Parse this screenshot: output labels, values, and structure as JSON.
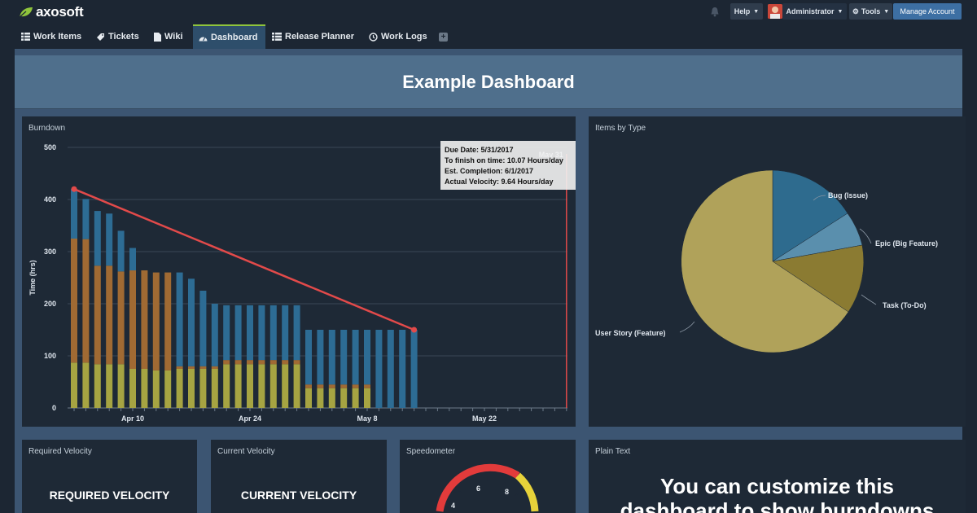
{
  "brand": {
    "name": "axosoft"
  },
  "topbar": {
    "help_label": "Help",
    "user_label": "Administrator",
    "tools_label": "Tools",
    "manage_label": "Manage Account"
  },
  "nav": {
    "tabs": [
      {
        "label": "Work Items",
        "icon": "list-icon"
      },
      {
        "label": "Tickets",
        "icon": "ticket-icon"
      },
      {
        "label": "Wiki",
        "icon": "document-icon"
      },
      {
        "label": "Dashboard",
        "icon": "dashboard-icon",
        "active": true
      },
      {
        "label": "Release Planner",
        "icon": "release-planner-icon"
      },
      {
        "label": "Work Logs",
        "icon": "clock-icon"
      }
    ],
    "add_label": "+"
  },
  "dashboard": {
    "title": "Example Dashboard",
    "burndown": {
      "title": "Burndown",
      "ylabel": "Time (hrs)",
      "y_ticks": [
        "500",
        "400",
        "300",
        "200",
        "100",
        "0"
      ],
      "x_ticks": [
        "Apr 10",
        "Apr 24",
        "May 8",
        "May 22"
      ],
      "marker_label": "May 31",
      "tooltip": {
        "line1": "Due Date: 5/31/2017",
        "line2": "To finish on time: 10.07 Hours/day",
        "line3": "Est. Completion: 6/1/2017",
        "line4": "Actual Velocity: 9.64 Hours/day"
      }
    },
    "items_by_type": {
      "title": "Items by Type",
      "labels": {
        "bug": "Bug (Issue)",
        "epic": "Epic (Big Feature)",
        "task": "Task (To-Do)",
        "story": "User Story (Feature)"
      }
    },
    "required_velocity": {
      "title": "Required Velocity",
      "big": "REQUIRED VELOCITY"
    },
    "current_velocity": {
      "title": "Current Velocity",
      "big": "CURRENT VELOCITY"
    },
    "speedometer": {
      "title": "Speedometer",
      "ticks": [
        "4",
        "6",
        "8"
      ]
    },
    "plain_text": {
      "title": "Plain Text",
      "line1": "You can customize this",
      "line2": "dashboard to show burndowns"
    }
  },
  "colors": {
    "blue": "#2d6c94",
    "orange": "#a06a33",
    "olive": "#a6a442",
    "ideal_line": "#e24a4a",
    "pie_story": "#b0a25a",
    "pie_bug": "#2e6b8e",
    "pie_epic": "#5a8fad",
    "pie_task": "#8b7b32"
  },
  "chart_data": {
    "type": "bar",
    "title": "Burndown",
    "ylabel": "Time (hrs)",
    "ylim": [
      0,
      500
    ],
    "x_ticks": [
      "Apr 10",
      "Apr 24",
      "May 8",
      "May 22"
    ],
    "series": [
      {
        "name": "",
        "color": "#a6a442",
        "values": [
          87,
          87,
          84,
          84,
          84,
          75,
          75,
          72,
          72,
          75,
          75,
          75,
          75,
          84,
          84,
          84,
          84,
          84,
          84,
          84,
          38,
          38,
          38,
          38,
          38,
          38,
          0,
          0,
          0,
          0,
          0,
          0
        ]
      },
      {
        "name": "",
        "color": "#a06a33",
        "values": [
          238,
          237,
          189,
          189,
          178,
          189,
          189,
          188,
          188,
          5,
          5,
          5,
          5,
          8,
          8,
          8,
          8,
          8,
          8,
          8,
          7,
          7,
          7,
          7,
          7,
          7,
          0,
          0,
          0,
          0,
          0,
          0
        ]
      },
      {
        "name": "",
        "color": "#2d6c94",
        "values": [
          95,
          77,
          105,
          100,
          78,
          43,
          0,
          0,
          0,
          180,
          168,
          145,
          120,
          105,
          105,
          105,
          105,
          105,
          105,
          105,
          105,
          105,
          105,
          105,
          105,
          105,
          150,
          150,
          150,
          150,
          0,
          0
        ]
      }
    ],
    "ideal_line": {
      "start": 420,
      "end": 150,
      "start_index": 0,
      "end_index": 29
    },
    "due_marker_index": 42
  }
}
